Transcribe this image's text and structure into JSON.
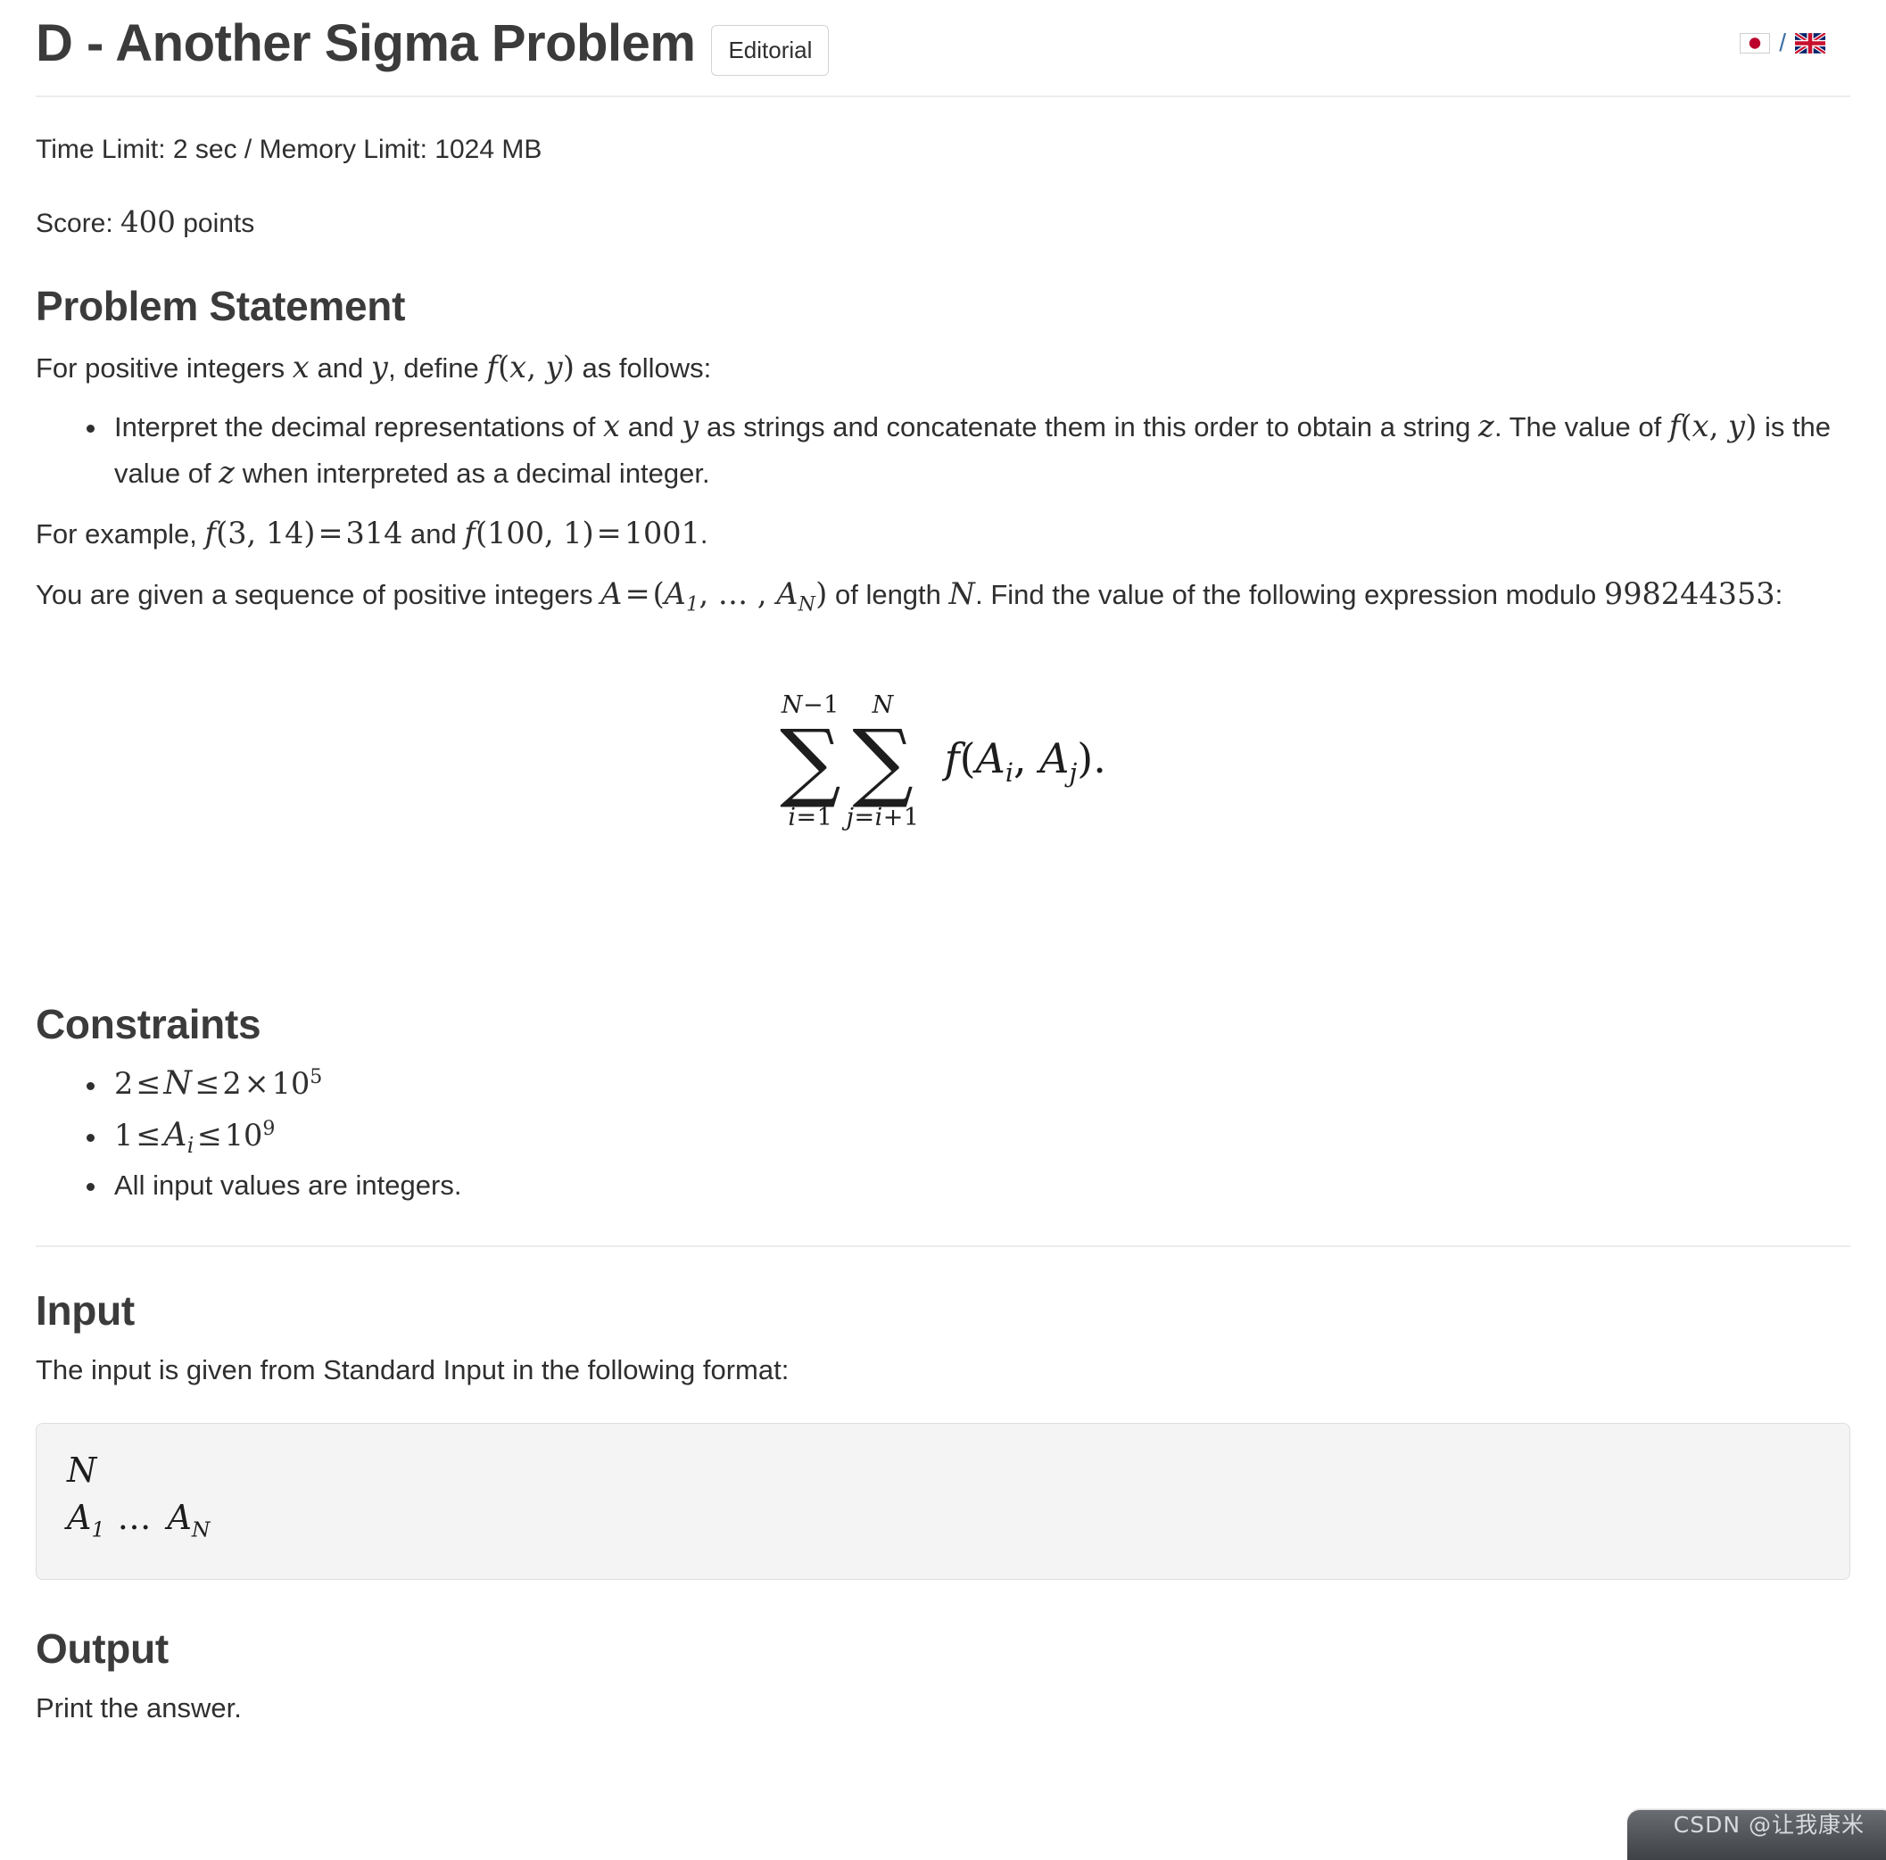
{
  "header": {
    "title": "D - Another Sigma Problem",
    "editorial_label": "Editorial",
    "lang_separator": "/",
    "lang_ja": "japan-flag",
    "lang_en": "uk-flag"
  },
  "meta": {
    "limits": "Time Limit: 2 sec / Memory Limit: 1024 MB",
    "time_limit": "2 sec",
    "memory_limit": "1024 MB",
    "score_prefix": "Score: ",
    "score_value": "400",
    "score_suffix": " points"
  },
  "problem_statement": {
    "heading": "Problem Statement",
    "intro_1": "For positive integers ",
    "intro_x": "x",
    "intro_2": " and ",
    "intro_y": "y",
    "intro_3": ", define ",
    "intro_f": "f(x, y)",
    "intro_4": " as follows:",
    "bullet_1a": "Interpret the decimal representations of ",
    "bullet_1x": "x",
    "bullet_1b": " and ",
    "bullet_1y": "y",
    "bullet_1c": " as strings and concatenate them in this order to obtain a string ",
    "bullet_1z": "z",
    "bullet_1d": ". The value of ",
    "bullet_1f": "f(x, y)",
    "bullet_1e": " is the value of ",
    "bullet_1z2": "z",
    "bullet_1g": " when interpreted as a decimal integer.",
    "example_prefix": "For example, ",
    "example_1": "f(3, 14) = 314",
    "example_mid": " and ",
    "example_2": "f(100, 1) = 1001",
    "example_end": ".",
    "given_1": "You are given a sequence of positive integers ",
    "given_seq": "A = (A1, ..., AN)",
    "given_2": " of length ",
    "given_N": "N",
    "given_3": ". Find the value of the following expression modulo ",
    "given_mod": "998244353",
    "given_4": ":"
  },
  "equation": {
    "outer_upper": "N-1",
    "outer_lower": "i=1",
    "inner_upper": "N",
    "inner_lower": "j=i+1",
    "sigma_glyph": "∑",
    "summand": "f(Ai, Aj)."
  },
  "constraints": {
    "heading": "Constraints",
    "items": [
      "2 ≤ N ≤ 2 × 10^5",
      "1 ≤ Ai ≤ 10^9",
      "All input values are integers."
    ]
  },
  "input": {
    "heading": "Input",
    "description": "The input is given from Standard Input in the following format:",
    "format_line_1": "N",
    "format_line_2": "A1 ... AN"
  },
  "output": {
    "heading": "Output",
    "description": "Print the answer."
  },
  "watermark": {
    "text": "CSDN @让我康米"
  },
  "colors": {
    "text": "#2f2f2f",
    "heading": "#3b3b3b",
    "rule": "#ececec",
    "code_bg": "#f4f4f4",
    "code_border": "#dedede",
    "link_blue": "#3b6ea5"
  }
}
